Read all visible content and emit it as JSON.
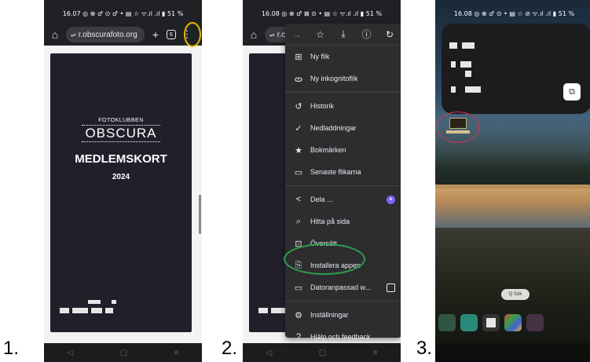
{
  "steps": [
    {
      "number": "1."
    },
    {
      "number": "2."
    },
    {
      "number": "3."
    }
  ],
  "phone1": {
    "status": "16.07 ◎ ⊕ ♂ ⊙ ♂ • ▤ ☆ ᯤ.ıl .ıl ▮ 51 %",
    "url": "r.obscurafoto.org",
    "tab_count": "6",
    "card": {
      "club_small": "FOTOKLUBBEN",
      "club_big": "OBSCURA",
      "title": "MEDLEMSKORT",
      "year": "2024"
    }
  },
  "phone2": {
    "status": "16.08 ◎ ⊕ ♂ ⊠ ⊙ • ▤ ☆ ᯤ.ıl .ıl ▮ 51 %",
    "url_partial": "r.c",
    "menu_items": [
      {
        "label": "Ny flik",
        "icon": "plus-box-icon"
      },
      {
        "label": "Ny inkognitoflik",
        "icon": "incognito-icon"
      },
      {
        "label": "Historik",
        "icon": "history-icon"
      },
      {
        "label": "Nedladdningar",
        "icon": "download-check-icon"
      },
      {
        "label": "Bokmärken",
        "icon": "star-icon"
      },
      {
        "label": "Senaste flikarna",
        "icon": "recent-tabs-icon"
      },
      {
        "label": "Dela ...",
        "icon": "share-icon"
      },
      {
        "label": "Hitta på sida",
        "icon": "find-in-page-icon"
      },
      {
        "label": "Översätt ...",
        "icon": "translate-icon"
      },
      {
        "label": "Installera appen",
        "icon": "install-app-icon"
      },
      {
        "label": "Datoranpassad w...",
        "icon": "desktop-site-icon"
      },
      {
        "label": "Inställningar",
        "icon": "settings-icon"
      },
      {
        "label": "Hjälp och feedback",
        "icon": "help-icon"
      }
    ]
  },
  "phone3": {
    "status": "16.08 ◎ ⊕ ♂ ⊙ • ▤ ☆ ⊘ ᯤ.ıl .ıl ▮ 51 %",
    "search_label": "Q Sök"
  },
  "colors": {
    "annotation_yellow": "#e6b800",
    "annotation_green": "#2ea04f",
    "annotation_red": "#e0304a"
  }
}
